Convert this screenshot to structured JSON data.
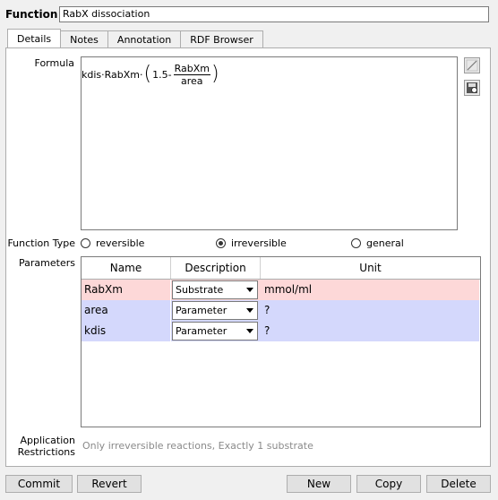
{
  "header": {
    "title": "Function",
    "name_value": "RabX dissociation"
  },
  "tabs": [
    "Details",
    "Notes",
    "Annotation",
    "RDF Browser"
  ],
  "details": {
    "formula_label": "Formula",
    "formula": {
      "prefix": "kdis·RabXm·",
      "constant": "1.5-",
      "numerator": "RabXm",
      "denominator": "area"
    },
    "function_type_label": "Function Type",
    "function_types": [
      "reversible",
      "irreversible",
      "general"
    ],
    "selected_type": "irreversible",
    "parameters_label": "Parameters",
    "parameters_columns": [
      "Name",
      "Description",
      "Unit"
    ],
    "parameters": [
      {
        "name": "RabXm",
        "description": "Substrate",
        "unit": "mmol/ml",
        "color": "#fdd8d8"
      },
      {
        "name": "area",
        "description": "Parameter",
        "unit": "?",
        "color": "#d4d8fc"
      },
      {
        "name": "kdis",
        "description": "Parameter",
        "unit": "?",
        "color": "#d4d8fc"
      }
    ],
    "application_label_1": "Application",
    "application_label_2": "Restrictions",
    "application_text": "Only irreversible reactions, Exactly 1 substrate"
  },
  "buttons": {
    "commit": "Commit",
    "revert": "Revert",
    "new": "New",
    "copy": "Copy",
    "delete": "Delete"
  },
  "icons": {
    "edit": "edit-formula-icon",
    "save": "save-formula-icon"
  }
}
